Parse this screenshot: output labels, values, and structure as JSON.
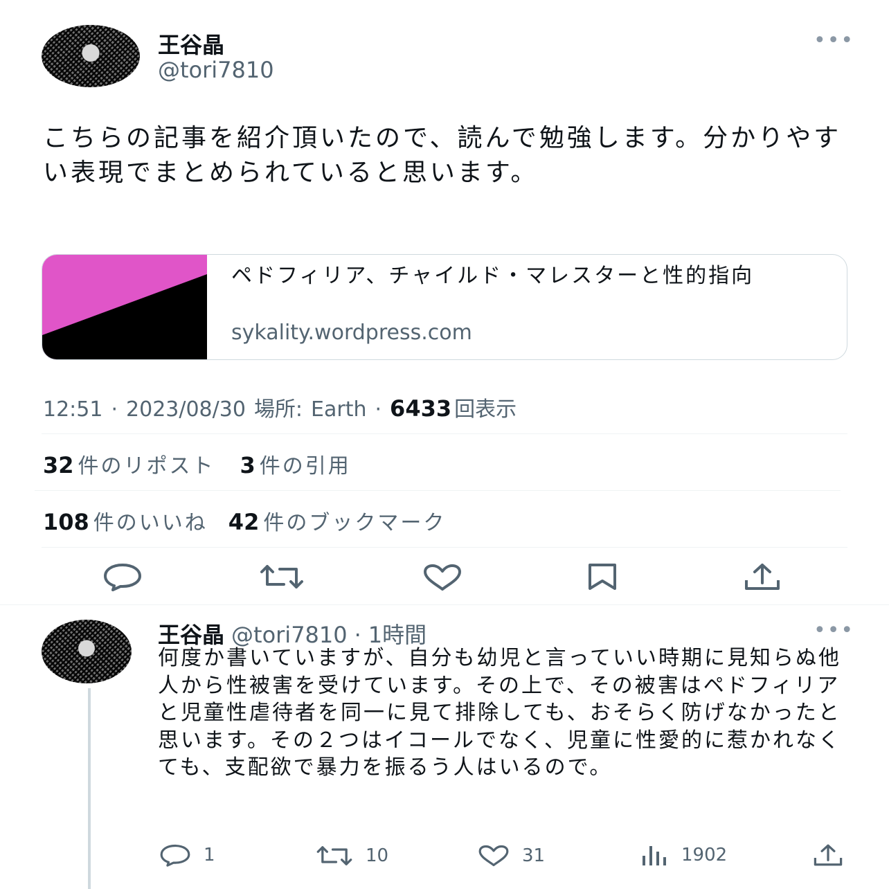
{
  "main_tweet": {
    "display_name": "王谷晶",
    "handle": "@tori7810",
    "text": "こちらの記事を紹介頂いたので、読んで勉強します。分かりやすい表現でまとめられていると思います。",
    "link_card": {
      "title": "ペドフィリア、チャイルド・マレスターと性的指向",
      "domain": "sykality.wordpress.com",
      "thumb_colors": [
        "#e055c8",
        "#000000"
      ]
    },
    "meta": {
      "time": "12:51",
      "sep1": "·",
      "date": "2023/08/30",
      "location_label": "場所:",
      "location": "Earth",
      "sep2": "·",
      "views": "6433",
      "views_label": "回表示"
    },
    "stats": {
      "reposts_count": "32",
      "reposts_label": "件のリポスト",
      "quotes_count": "3",
      "quotes_label": "件の引用",
      "likes_count": "108",
      "likes_label": "件のいいね",
      "bookmarks_count": "42",
      "bookmarks_label": "件のブックマーク"
    },
    "actions": [
      "reply-icon",
      "repost-icon",
      "like-icon",
      "bookmark-icon",
      "share-icon"
    ]
  },
  "reply": {
    "display_name": "王谷晶",
    "handle": "@tori7810",
    "sep": "·",
    "time_ago": "1時間",
    "text": "何度か書いていますが、自分も幼児と言っていい時期に見知らぬ他人から性被害を受けています。その上で、その被害はペドフィリアと児童性虐待者を同一に見て排除しても、おそらく防げなかったと思います。その２つはイコールでなく、児童に性愛的に惹かれなくても、支配欲で暴力を振るう人はいるので。",
    "counts": {
      "replies": "1",
      "reposts": "10",
      "likes": "31",
      "views": "1902"
    }
  },
  "colors": {
    "text": "#0f1419",
    "muted": "#536471",
    "border": "#eff3f4"
  }
}
